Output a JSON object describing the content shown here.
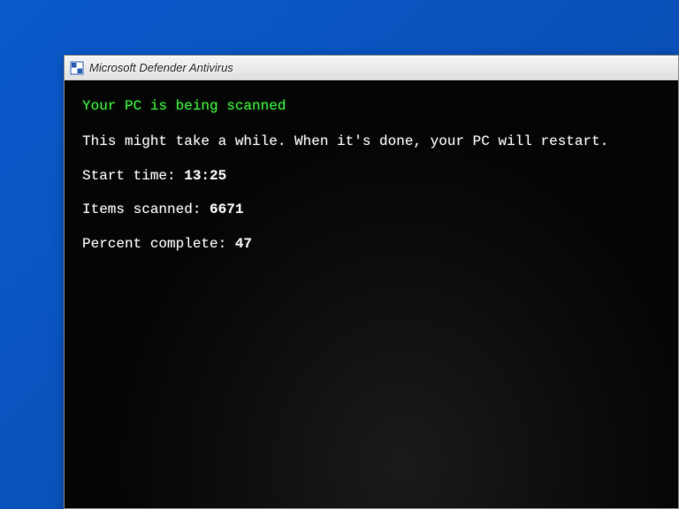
{
  "window": {
    "title": "Microsoft Defender Antivirus"
  },
  "scan": {
    "heading": "Your PC is being scanned",
    "subtext": "This might take a while. When it's done, your PC will restart.",
    "start_label": "Start time: ",
    "start_value": "13:25",
    "items_label": "Items scanned: ",
    "items_value": "6671",
    "percent_label": "Percent complete: ",
    "percent_value": "47"
  }
}
